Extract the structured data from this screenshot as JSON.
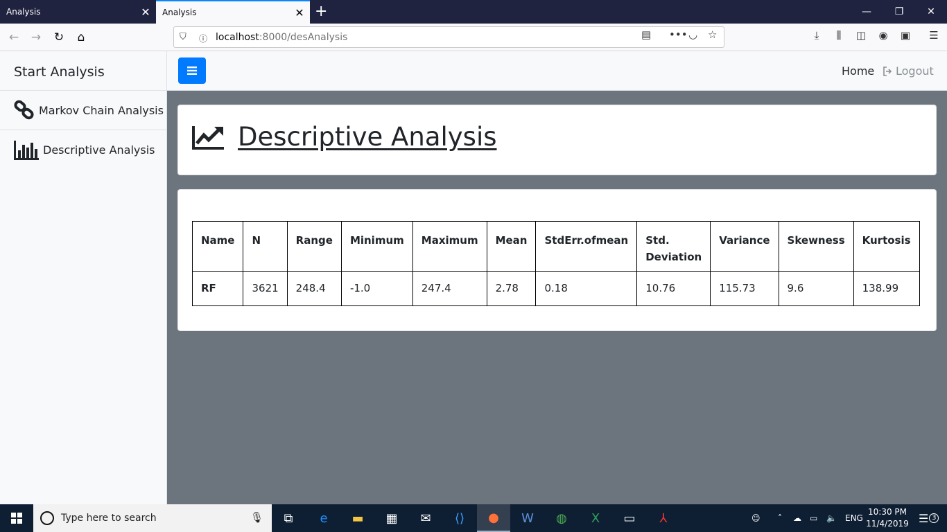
{
  "browser": {
    "tabs": [
      {
        "title": "Analysis",
        "active": false
      },
      {
        "title": "Analysis",
        "active": true
      }
    ],
    "url_host": "localhost",
    "url_path": ":8000/desAnalysis"
  },
  "sidebar": {
    "title": "Start Analysis",
    "items": [
      {
        "label": "Markov Chain Analysis",
        "icon": "link-icon"
      },
      {
        "label": "Descriptive Analysis",
        "icon": "bar-chart-icon"
      }
    ]
  },
  "topnav": {
    "home": "Home",
    "logout": "Logout"
  },
  "page": {
    "title": "Descriptive Analysis",
    "title_icon": "line-chart-icon"
  },
  "stats_table": {
    "headers": [
      "Name",
      "N",
      "Range",
      "Minimum",
      "Maximum",
      "Mean",
      "StdErr.ofmean",
      "Std. Deviation",
      "Variance",
      "Skewness",
      "Kurtosis"
    ],
    "rows": [
      [
        "RF",
        "3621",
        "248.4",
        "-1.0",
        "247.4",
        "2.78",
        "0.18",
        "10.76",
        "115.73",
        "9.6",
        "138.99"
      ]
    ]
  },
  "taskbar": {
    "search_placeholder": "Type here to search",
    "language": "ENG",
    "time": "10:30 PM",
    "date": "11/4/2019",
    "notification_count": "3"
  },
  "colors": {
    "accent": "#007bff",
    "content_bg": "#6c757d",
    "tab_bar": "#202340",
    "taskbar": "#0f1f33"
  }
}
